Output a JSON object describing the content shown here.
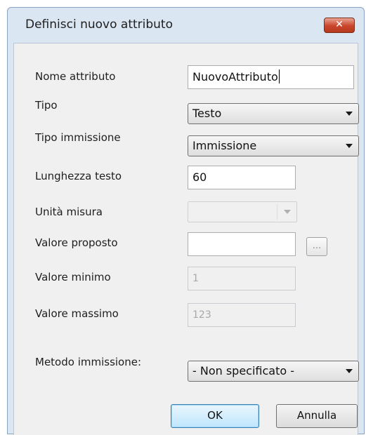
{
  "dialog": {
    "title": "Definisci nuovo attributo",
    "close_symbol": "✕"
  },
  "form": {
    "nome": {
      "label": "Nome attributo",
      "value": "NuovoAttributo"
    },
    "tipo": {
      "label": "Tipo",
      "value": "Testo"
    },
    "tipo_immissione": {
      "label": "Tipo immissione",
      "value": "Immissione"
    },
    "lunghezza": {
      "label": "Lunghezza testo",
      "value": "60"
    },
    "unita": {
      "label": "Unità misura",
      "value": ""
    },
    "valore_proposto": {
      "label": "Valore proposto",
      "value": "",
      "browse_label": "..."
    },
    "valore_minimo": {
      "label": "Valore minimo",
      "value": "1"
    },
    "valore_massimo": {
      "label": "Valore massimo",
      "value": "123"
    },
    "metodo": {
      "label": "Metodo immissione:",
      "value": "- Non specificato -"
    }
  },
  "buttons": {
    "ok": "OK",
    "annulla": "Annulla"
  },
  "colors": {
    "titlebar": "#dbe6f3",
    "client": "#f0f0f0",
    "close": "#c9452a",
    "default_button": "#bee6fd"
  }
}
